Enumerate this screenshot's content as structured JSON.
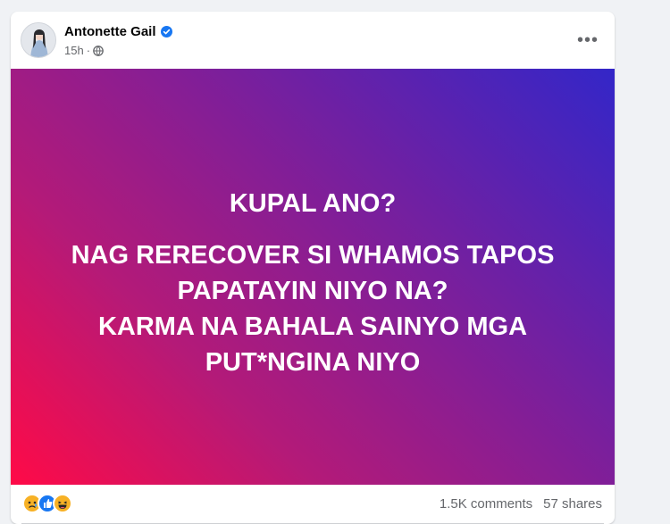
{
  "post": {
    "author_name": "Antonette Gail",
    "timestamp": "15h",
    "privacy_separator": "·",
    "privacy_icon": "globe-icon",
    "verified_icon": "verified-badge-icon",
    "more_icon": "more-options-icon",
    "more_label": "•••",
    "lines": [
      "KUPAL ANO?",
      "NAG RERECOVER SI WHAMOS TAPOS",
      "PAPATAYIN NIYO NA?",
      "KARMA NA BAHALA SAINYO MGA",
      "PUT*NGINA NIYO"
    ],
    "background_colors": [
      "#ff0a47",
      "#b41a78",
      "#7a1f9c",
      "#3326c8"
    ]
  },
  "footer": {
    "reactions": [
      "sad-icon",
      "like-icon",
      "haha-icon"
    ],
    "comments": "1.5K comments",
    "shares": "57 shares"
  },
  "colors": {
    "like": "#1877f2",
    "emoji": "#f7b125",
    "secondary_text": "#65676b"
  }
}
